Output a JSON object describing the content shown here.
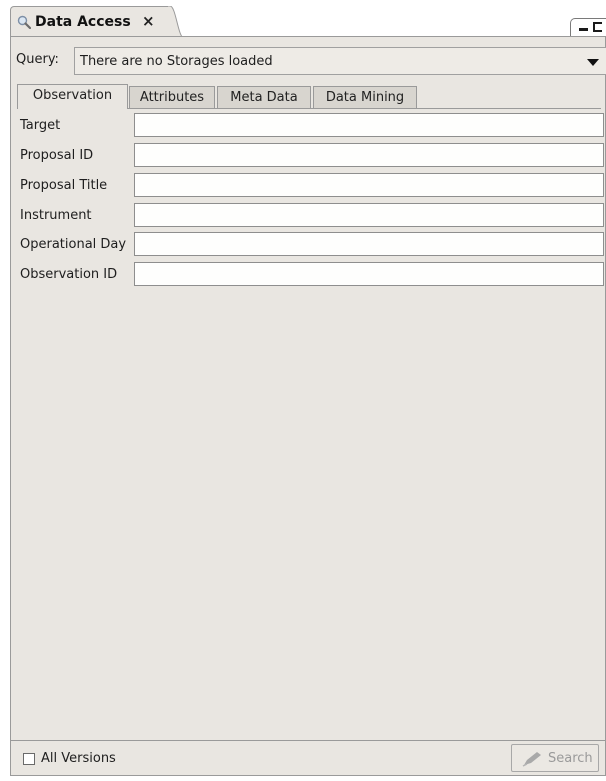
{
  "view_tab": {
    "title": "Data Access",
    "close": "×"
  },
  "query": {
    "label": "Query:",
    "selected": "There are no Storages loaded"
  },
  "tabs": [
    {
      "label": "Observation",
      "active": true
    },
    {
      "label": "Attributes",
      "active": false
    },
    {
      "label": "Meta Data",
      "active": false
    },
    {
      "label": "Data Mining",
      "active": false
    }
  ],
  "fields": [
    {
      "label": "Target",
      "value": ""
    },
    {
      "label": "Proposal ID",
      "value": ""
    },
    {
      "label": "Proposal Title",
      "value": ""
    },
    {
      "label": "Instrument",
      "value": ""
    },
    {
      "label": "Operational Day",
      "value": ""
    },
    {
      "label": "Observation ID",
      "value": ""
    }
  ],
  "footer": {
    "all_versions_label": "All Versions",
    "all_versions_checked": false,
    "search_label": "Search",
    "search_enabled": false
  },
  "icons": {
    "view_tab": "magnifier-icon",
    "close": "close-icon",
    "minimize": "minimize-icon",
    "maximize": "maximize-icon",
    "dropdown": "chevron-down-icon",
    "search": "pen-icon"
  }
}
